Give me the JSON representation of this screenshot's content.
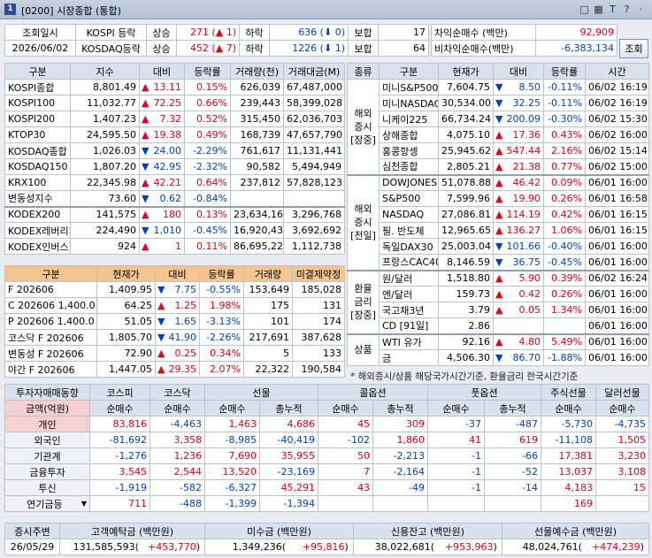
{
  "window": {
    "num": "1",
    "title": "[0200] 시장종합 (통합)",
    "icons": [
      "□",
      "▦",
      "T",
      "?",
      "·"
    ]
  },
  "top": {
    "label_date": "조회일시",
    "date": "2026/06/02",
    "rows": [
      {
        "market": "KOSPI 등락",
        "up_label": "상승",
        "up": "271",
        "up_arrow": "▲",
        "up_cnt": "1",
        "dn_label": "하락",
        "dn": "636",
        "dn_arrow": "⬇",
        "dn_cnt": "0",
        "flat_label": "보합",
        "flat": "17"
      },
      {
        "market": "KOSDAQ등락",
        "up_label": "상승",
        "up": "452",
        "up_arrow": "▲",
        "up_cnt": "7",
        "dn_label": "하락",
        "dn": "1226",
        "dn_arrow": "⬇",
        "dn_cnt": "1",
        "flat_label": "보합",
        "flat": "64"
      }
    ],
    "arb": [
      {
        "label": "차익순매수 (백만)",
        "value": "92,909"
      },
      {
        "label": "비차익순매수(백만)",
        "value": "-6,383,134"
      }
    ],
    "query_btn": "조회"
  },
  "left": {
    "headers": [
      "구분",
      "지수",
      "대비",
      "등락률",
      "거래량(천)",
      "거래대금(M)"
    ],
    "rows": [
      [
        "KOSPI종합",
        "8,801.49",
        "▲",
        "13.11",
        "0.15%",
        "626,039",
        "67,487,000",
        "up"
      ],
      [
        "KOSPI100",
        "11,032.77",
        "▲",
        "72.25",
        "0.66%",
        "239,443",
        "58,399,028",
        "up"
      ],
      [
        "KOSPI200",
        "1,407.23",
        "▲",
        "7.32",
        "0.52%",
        "315,450",
        "62,036,703",
        "up"
      ],
      [
        "KTOP30",
        "24,595.50",
        "▲",
        "19.38",
        "0.49%",
        "168,739",
        "47,657,790",
        "up"
      ],
      [
        "KOSDAQ종합",
        "1,026.03",
        "▼",
        "24.00",
        "-2.29%",
        "761,617",
        "11,131,441",
        "dn"
      ],
      [
        "KOSDAQ150",
        "1,807.20",
        "▼",
        "42.95",
        "-2.32%",
        "90,582",
        "5,494,949",
        "dn"
      ],
      [
        "KRX100",
        "22,345.98",
        "▲",
        "42.21",
        "0.64%",
        "237,812",
        "57,828,123",
        "up"
      ],
      [
        "변동성지수",
        "73.60",
        "▼",
        "0.62",
        "-0.84%",
        "",
        "",
        "dn"
      ]
    ],
    "etf": [
      [
        "KODEX200",
        "141,575",
        "▲",
        "180",
        "0.13%",
        "23,634,160",
        "3,296,768",
        "up"
      ],
      [
        "KODEX레버리지",
        "224,490",
        "▼",
        "1,010",
        "-0.45%",
        "16,920,436",
        "3,692,692",
        "dn"
      ],
      [
        "KODEX인버스",
        "924",
        "▲",
        "1",
        "0.11%",
        "86,695,220",
        "1,112,738",
        "up"
      ]
    ],
    "fut_headers": [
      "구분",
      "현재가",
      "대비",
      "등락률",
      "거래량",
      "미결제약정"
    ],
    "fut": [
      [
        "F 202606",
        "1,409.95",
        "▼",
        "7.75",
        "-0.55%",
        "153,649",
        "185,028",
        "dn"
      ],
      [
        "C 202606 1,400.0",
        "64.25",
        "▲",
        "1.25",
        "1.98%",
        "175",
        "131",
        "up"
      ],
      [
        "P 202606 1,400.0",
        "51.05",
        "▼",
        "1.65",
        "-3.13%",
        "101",
        "174",
        "dn"
      ],
      [
        "코스닥 F 202606",
        "1,805.70",
        "▼",
        "41.90",
        "-2.26%",
        "217,691",
        "387,628",
        "dn"
      ],
      [
        "변동성 F 202606",
        "72.90",
        "▲",
        "0.25",
        "0.34%",
        "5",
        "133",
        "up"
      ],
      [
        "야간 F 202606",
        "1,447.05",
        "▲",
        "29.35",
        "2.07%",
        "22,322",
        "190,584",
        "up"
      ]
    ]
  },
  "right": {
    "headers": [
      "종류",
      "구분",
      "현재가",
      "대비",
      "등락률",
      "시간"
    ],
    "groups": [
      {
        "name": "해외\n증시\n[장중]",
        "rows": [
          [
            "미니S&P500",
            "7,604.75",
            "▼",
            "8.50",
            "-0.11%",
            "06/02 16:19",
            "dn"
          ],
          [
            "미니NASDAQ",
            "30,534.00",
            "▼",
            "32.25",
            "-0.11%",
            "06/02 16:19",
            "dn"
          ],
          [
            "니케이225",
            "66,734.24",
            "▼",
            "200.09",
            "-0.30%",
            "06/02 15:30",
            "dn"
          ],
          [
            "상해종합",
            "4,075.10",
            "▲",
            "17.36",
            "0.43%",
            "06/02 16:00",
            "up"
          ],
          [
            "홍콩항셍",
            "25,945.62",
            "▲",
            "547.44",
            "2.16%",
            "06/02 15:14",
            "up"
          ],
          [
            "심천종합",
            "2,805.21",
            "▲",
            "21.38",
            "0.77%",
            "06/02 15:00",
            "up"
          ]
        ]
      },
      {
        "name": "해외\n증시\n[전일]",
        "rows": [
          [
            "DOWJONES",
            "51,078.88",
            "▲",
            "46.42",
            "0.09%",
            "06/01 16:00",
            "up"
          ],
          [
            "S&P500",
            "7,599.96",
            "▲",
            "19.90",
            "0.26%",
            "06/01 16:58",
            "up"
          ],
          [
            "NASDAQ",
            "27,086.81",
            "▲",
            "114.19",
            "0.42%",
            "06/01 16:15",
            "up"
          ],
          [
            "필. 반도체",
            "12,965.65",
            "▲",
            "136.27",
            "1.06%",
            "06/01 16:15",
            "up"
          ],
          [
            "독일DAX30",
            "25,003.04",
            "▼",
            "101.66",
            "-0.40%",
            "06/01 16:00",
            "dn"
          ],
          [
            "프랑스CAC40",
            "8,146.59",
            "▼",
            "36.75",
            "-0.45%",
            "06/01 16:00",
            "dn"
          ]
        ]
      },
      {
        "name": "환율\n금리\n[장중]",
        "rows": [
          [
            "원/달러",
            "1,518.80",
            "▲",
            "5.90",
            "0.39%",
            "06/02 16:24",
            "up"
          ],
          [
            "엔/달러",
            "159.73",
            "▲",
            "0.42",
            "0.26%",
            "06/01 16:00",
            "up"
          ],
          [
            "국고채3년",
            "3.79",
            "▲",
            "0.05",
            "1.34%",
            "06/01 16:00",
            "up"
          ],
          [
            "CD [91일]",
            "2.86",
            "",
            "",
            "",
            "06/01 16:00",
            ""
          ]
        ]
      },
      {
        "name": "상품",
        "rows": [
          [
            "WTI 유가",
            "92.16",
            "▲",
            "4.80",
            "5.49%",
            "06/01 16:00",
            "up"
          ],
          [
            "금",
            "4,506.30",
            "▼",
            "86.70",
            "-1.88%",
            "06/01 16:00",
            "dn"
          ]
        ]
      }
    ],
    "note": "* 해외증시/상품 해당국가시간기준, 환율금리 한국시간기준"
  },
  "investor": {
    "h1": [
      "투자자매매동향",
      "코스피",
      "코스닥",
      "선물",
      "콜옵션",
      "풋옵션",
      "주식선물",
      "달러선물"
    ],
    "h2": [
      "금액(억원)",
      "순매수",
      "순매수",
      "순매수",
      "총누적",
      "순매수",
      "총누적",
      "순매수",
      "총누적",
      "순매수",
      "순매수"
    ],
    "rows": [
      [
        "개인",
        "83,816",
        "-4,463",
        "1,463",
        "4,686",
        "45",
        "309",
        "-37",
        "-487",
        "-5,730",
        "-4,735"
      ],
      [
        "외국인",
        "-81,692",
        "3,358",
        "-8,985",
        "-40,419",
        "-102",
        "1,860",
        "41",
        "619",
        "-11,108",
        "1,505"
      ],
      [
        "기관계",
        "-1,276",
        "1,236",
        "7,690",
        "35,955",
        "50",
        "-2,213",
        "-1",
        "-66",
        "17,381",
        "3,230"
      ],
      [
        "금융투자",
        "3,545",
        "2,544",
        "13,520",
        "-23,169",
        "7",
        "-2,164",
        "-1",
        "-52",
        "13,037",
        "3,108"
      ],
      [
        "투신",
        "-1,919",
        "-582",
        "-6,327",
        "45,291",
        "43",
        "-49",
        "-1",
        "-14",
        "4,183",
        "15"
      ],
      [
        "연기금등",
        "711",
        "-488",
        "-1,399",
        "-1,394",
        "",
        "",
        "",
        "",
        "169",
        ""
      ]
    ],
    "dropdown_arrow": "▼"
  },
  "bottom": {
    "headers": [
      "증시주변",
      "고객예탁금 (백만원)",
      "미수금 (백만원)",
      "신용잔고 (백만원)",
      "선물예수금 (백만원)"
    ],
    "date": "26/05/29",
    "vals": [
      [
        "131,585,593",
        "+453,770"
      ],
      [
        "1,349,236",
        "+95,816"
      ],
      [
        "38,022,681",
        "+953,963"
      ],
      [
        "48,024,761",
        "+474,239"
      ]
    ]
  }
}
